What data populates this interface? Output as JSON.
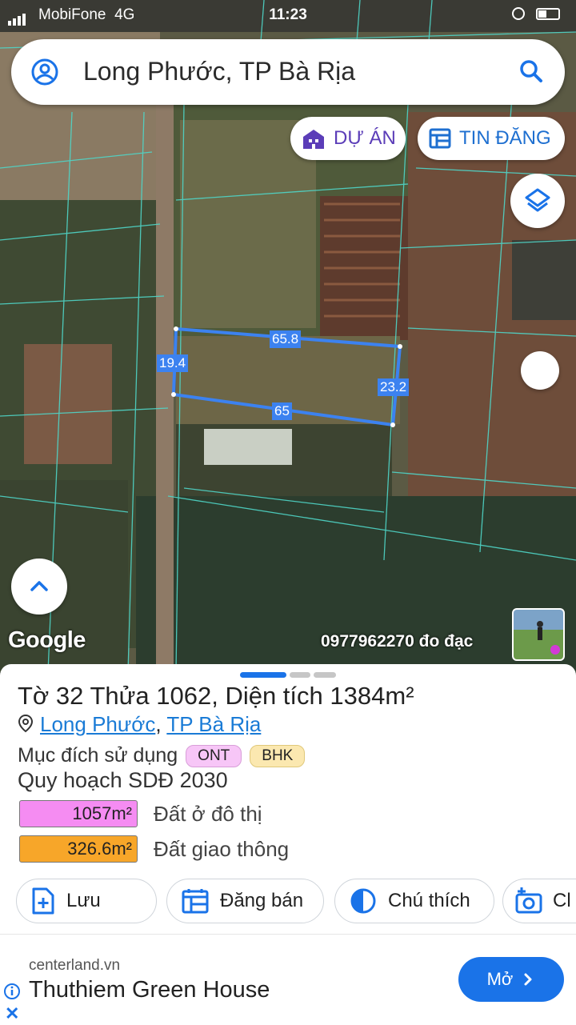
{
  "status": {
    "carrier": "MobiFone",
    "network": "4G",
    "time": "11:23"
  },
  "search": {
    "text": "Long Phước, TP Bà Rịa"
  },
  "chips": {
    "du_an": "DỰ ÁN",
    "tin_dang": "TIN ĐĂNG"
  },
  "parcel": {
    "top": "65.8",
    "left": "19.4",
    "right": "23.2",
    "bottom": "65"
  },
  "map": {
    "google": "Google",
    "watermark": "0977962270 đo đạc"
  },
  "sheet": {
    "title_to": "Tờ",
    "to_num": "32",
    "title_thua": "Thửa",
    "thua_num": "1062",
    "title_dt": "Diện tích",
    "area": "1384",
    "area_unit": "m²",
    "loc_part1": "Long Phước",
    "loc_sep": ",",
    "loc_part2": "TP Bà Rịa",
    "purpose_label": "Mục đích sử dụng",
    "tags": [
      {
        "text": "ONT",
        "color": "#f7c6f7"
      },
      {
        "text": "BHK",
        "color": "#fbe8b0"
      }
    ],
    "plan_title": "Quy hoạch SDĐ 2030",
    "plan_items": [
      {
        "value": "1057m²",
        "label": "Đất ở đô thị",
        "color": "#f58cf2"
      },
      {
        "value": "326.6m²",
        "label": "Đất giao thông",
        "color": "#f7a629"
      }
    ],
    "actions": {
      "save": "Lưu",
      "sell": "Đăng bán",
      "legend": "Chú thích",
      "camera": "Cl"
    }
  },
  "ad": {
    "domain": "centerland.vn",
    "name": "Thuthiem Green House",
    "button": "Mở"
  },
  "colors": {
    "accent_blue": "#1a73e8",
    "parcel_line": "#3c82f0",
    "project_purple": "#5b3db8"
  }
}
